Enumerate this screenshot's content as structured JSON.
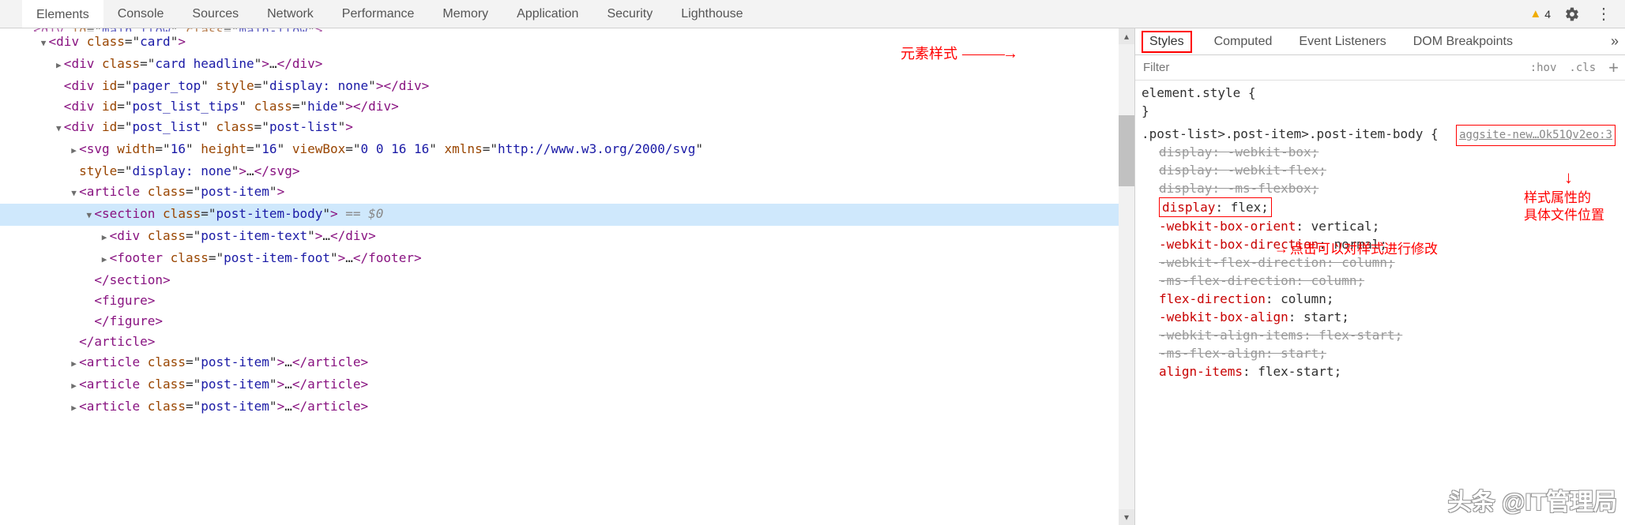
{
  "toolbar": {
    "tabs": [
      "Elements",
      "Console",
      "Sources",
      "Network",
      "Performance",
      "Memory",
      "Application",
      "Security",
      "Lighthouse"
    ],
    "active_tab": "Elements",
    "warning_count": "4"
  },
  "dom": {
    "lines": [
      {
        "indent": 1,
        "toggle": "",
        "html": "<span class='brkt'>&lt;</span><span class='tag'>div</span> <span class='attr-name'>id</span><span class='eqq'>=\"</span><span class='attr-value'>main_flow</span><span class='eqq'>\"</span> <span class='attr-name'>class</span><span class='eqq'>=\"</span><span class='attr-value'>main-flow</span><span class='eqq'>\"</span><span class='brkt'>&gt;</span>",
        "cut": true
      },
      {
        "indent": 2,
        "toggle": "▼",
        "html": "<span class='brkt'>&lt;</span><span class='tag'>div</span> <span class='attr-name'>class</span><span class='eqq'>=\"</span><span class='attr-value'>card</span><span class='eqq'>\"</span><span class='brkt'>&gt;</span>"
      },
      {
        "indent": 3,
        "toggle": "▶",
        "html": "<span class='brkt'>&lt;</span><span class='tag'>div</span> <span class='attr-name'>class</span><span class='eqq'>=\"</span><span class='attr-value'>card headline</span><span class='eqq'>\"</span><span class='brkt'>&gt;</span>…<span class='brkt'>&lt;/</span><span class='tag'>div</span><span class='brkt'>&gt;</span>"
      },
      {
        "indent": 3,
        "toggle": "",
        "html": "<span class='brkt'>&lt;</span><span class='tag'>div</span> <span class='attr-name'>id</span><span class='eqq'>=\"</span><span class='attr-value'>pager_top</span><span class='eqq'>\"</span> <span class='attr-name'>style</span><span class='eqq'>=\"</span><span class='attr-value'>display: none</span><span class='eqq'>\"</span><span class='brkt'>&gt;&lt;/</span><span class='tag'>div</span><span class='brkt'>&gt;</span>"
      },
      {
        "indent": 3,
        "toggle": "",
        "html": "<span class='brkt'>&lt;</span><span class='tag'>div</span> <span class='attr-name'>id</span><span class='eqq'>=\"</span><span class='attr-value'>post_list_tips</span><span class='eqq'>\"</span> <span class='attr-name'>class</span><span class='eqq'>=\"</span><span class='attr-value'>hide</span><span class='eqq'>\"</span><span class='brkt'>&gt;&lt;/</span><span class='tag'>div</span><span class='brkt'>&gt;</span>"
      },
      {
        "indent": 3,
        "toggle": "▼",
        "html": "<span class='brkt'>&lt;</span><span class='tag'>div</span> <span class='attr-name'>id</span><span class='eqq'>=\"</span><span class='attr-value'>post_list</span><span class='eqq'>\"</span> <span class='attr-name'>class</span><span class='eqq'>=\"</span><span class='attr-value'>post-list</span><span class='eqq'>\"</span><span class='brkt'>&gt;</span>"
      },
      {
        "indent": 4,
        "toggle": "▶",
        "html": "<span class='brkt'>&lt;</span><span class='tag'>svg</span> <span class='attr-name'>width</span><span class='eqq'>=\"</span><span class='attr-value'>16</span><span class='eqq'>\"</span> <span class='attr-name'>height</span><span class='eqq'>=\"</span><span class='attr-value'>16</span><span class='eqq'>\"</span> <span class='attr-name'>viewBox</span><span class='eqq'>=\"</span><span class='attr-value'>0 0 16 16</span><span class='eqq'>\"</span> <span class='attr-name'>xmlns</span><span class='eqq'>=\"</span><span class='attr-value'>http://www.w3.org/2000/svg</span><span class='eqq'>\"</span>"
      },
      {
        "indent": 4,
        "toggle": "",
        "html": "<span class='attr-name'>style</span><span class='eqq'>=\"</span><span class='attr-value'>display: none</span><span class='eqq'>\"</span><span class='brkt'>&gt;</span>…<span class='brkt'>&lt;/</span><span class='tag'>svg</span><span class='brkt'>&gt;</span>"
      },
      {
        "indent": 4,
        "toggle": "▼",
        "html": "<span class='brkt'>&lt;</span><span class='tag'>article</span> <span class='attr-name'>class</span><span class='eqq'>=\"</span><span class='attr-value'>post-item</span><span class='eqq'>\"</span><span class='brkt'>&gt;</span>"
      },
      {
        "indent": 5,
        "toggle": "▼",
        "selected": true,
        "html": "<span class='brkt'>&lt;</span><span class='tag'>section</span> <span class='attr-name'>class</span><span class='eqq'>=\"</span><span class='attr-value'>post-item-body</span><span class='eqq'>\"</span><span class='brkt'>&gt;</span> <span class='sel-hint'>== $0</span>"
      },
      {
        "indent": 6,
        "toggle": "▶",
        "html": "<span class='brkt'>&lt;</span><span class='tag'>div</span> <span class='attr-name'>class</span><span class='eqq'>=\"</span><span class='attr-value'>post-item-text</span><span class='eqq'>\"</span><span class='brkt'>&gt;</span>…<span class='brkt'>&lt;/</span><span class='tag'>div</span><span class='brkt'>&gt;</span>"
      },
      {
        "indent": 6,
        "toggle": "▶",
        "html": "<span class='brkt'>&lt;</span><span class='tag'>footer</span> <span class='attr-name'>class</span><span class='eqq'>=\"</span><span class='attr-value'>post-item-foot</span><span class='eqq'>\"</span><span class='brkt'>&gt;</span>…<span class='brkt'>&lt;/</span><span class='tag'>footer</span><span class='brkt'>&gt;</span>"
      },
      {
        "indent": 5,
        "toggle": "",
        "html": "<span class='brkt'>&lt;/</span><span class='tag'>section</span><span class='brkt'>&gt;</span>"
      },
      {
        "indent": 5,
        "toggle": "",
        "html": "<span class='brkt'>&lt;</span><span class='tag'>figure</span><span class='brkt'>&gt;</span>"
      },
      {
        "indent": 5,
        "toggle": "",
        "html": "<span class='brkt'>&lt;/</span><span class='tag'>figure</span><span class='brkt'>&gt;</span>"
      },
      {
        "indent": 4,
        "toggle": "",
        "html": "<span class='brkt'>&lt;/</span><span class='tag'>article</span><span class='brkt'>&gt;</span>"
      },
      {
        "indent": 4,
        "toggle": "▶",
        "html": "<span class='brkt'>&lt;</span><span class='tag'>article</span> <span class='attr-name'>class</span><span class='eqq'>=\"</span><span class='attr-value'>post-item</span><span class='eqq'>\"</span><span class='brkt'>&gt;</span>…<span class='brkt'>&lt;/</span><span class='tag'>article</span><span class='brkt'>&gt;</span>"
      },
      {
        "indent": 4,
        "toggle": "▶",
        "html": "<span class='brkt'>&lt;</span><span class='tag'>article</span> <span class='attr-name'>class</span><span class='eqq'>=\"</span><span class='attr-value'>post-item</span><span class='eqq'>\"</span><span class='brkt'>&gt;</span>…<span class='brkt'>&lt;/</span><span class='tag'>article</span><span class='brkt'>&gt;</span>"
      },
      {
        "indent": 4,
        "toggle": "▶",
        "html": "<span class='brkt'>&lt;</span><span class='tag'>article</span> <span class='attr-name'>class</span><span class='eqq'>=\"</span><span class='attr-value'>post-item</span><span class='eqq'>\"</span><span class='brkt'>&gt;</span>…<span class='brkt'>&lt;/</span><span class='tag'>article</span><span class='brkt'>&gt;</span>"
      }
    ]
  },
  "styles_panel": {
    "tabs": [
      "Styles",
      "Computed",
      "Event Listeners",
      "DOM Breakpoints"
    ],
    "active_tab": "Styles",
    "filter_placeholder": "Filter",
    "hov": ":hov",
    "cls": ".cls",
    "rule1": {
      "selector": "element.style {",
      "close": "}"
    },
    "rule2": {
      "selector": ".post-list>.post-item>.post-item-body {",
      "source": "aggsite-new…Ok51Qv2eo:3",
      "decls": [
        {
          "prop": "display",
          "val": "-webkit-box",
          "strike": true
        },
        {
          "prop": "display",
          "val": "-webkit-flex",
          "strike": true
        },
        {
          "prop": "display",
          "val": "-ms-flexbox",
          "strike": true
        },
        {
          "prop": "display",
          "val": "flex",
          "boxed": true
        },
        {
          "prop": "-webkit-box-orient",
          "val": "vertical"
        },
        {
          "prop": "-webkit-box-direction",
          "val": "normal"
        },
        {
          "prop": "-webkit-flex-direction",
          "val": "column",
          "strike": true
        },
        {
          "prop": "-ms-flex-direction",
          "val": "column",
          "strike": true
        },
        {
          "prop": "flex-direction",
          "val": "column"
        },
        {
          "prop": "-webkit-box-align",
          "val": "start"
        },
        {
          "prop": "-webkit-align-items",
          "val": "flex-start",
          "strike": true
        },
        {
          "prop": "-ms-flex-align",
          "val": "start",
          "strike": true
        },
        {
          "prop": "align-items",
          "val": "flex-start"
        }
      ]
    }
  },
  "annotations": {
    "left": "元素样式",
    "file": "样式属性的\n具体文件位置",
    "edit": "点击可以对样式进行修改"
  },
  "watermark": "头条 @IT管理局"
}
